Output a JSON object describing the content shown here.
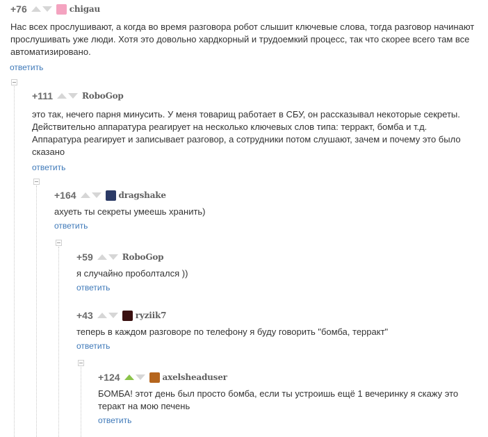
{
  "comments": [
    {
      "rating": "+76",
      "author": "chigau",
      "avatar_color": "#f4a3c0",
      "text": "Нас всех прослушивают, а когда во время разговора робот слышит ключевые слова, тогда разговор начинают прослушивать уже люди. Хотя это довольно хардкорный и трудоемкий процесс, так что скорее всего там все автоматизировано.",
      "reply": "ответить",
      "upvoted": false
    },
    {
      "rating": "+111",
      "author": "RoboGop",
      "avatar_color": "",
      "text": "это так, нечего парня минусить. У меня товарищ работает в СБУ, он рассказывал некоторые секреты. Действительно аппаратура реагирует на несколько ключевых слов типа: терракт, бомба и т.д. Аппаратура реагирует и записывает разговор, а сотрудники потом слушают, зачем и почему это было сказано",
      "reply": "ответить",
      "upvoted": false
    },
    {
      "rating": "+164",
      "author": "dragshake",
      "avatar_color": "#2b3a66",
      "text": "ахуеть ты секреты умеешь хранить)",
      "reply": "ответить",
      "upvoted": false
    },
    {
      "rating": "+59",
      "author": "RoboGop",
      "avatar_color": "",
      "text": "я случайно проболтался ))",
      "reply": "ответить",
      "upvoted": false
    },
    {
      "rating": "+43",
      "author": "ryziik7",
      "avatar_color": "#3a1010",
      "text": "теперь в каждом разговоре по телефону я буду говорить \"бомба, терракт\"",
      "reply": "ответить",
      "upvoted": false
    },
    {
      "rating": "+124",
      "author": "axelsheaduser",
      "avatar_color": "#b5651d",
      "text": "БОМБА! этот день был просто бомба, если ты устроишь ещё 1 вечеринку я скажу это теракт на мою печень",
      "reply": "ответить",
      "upvoted": true
    }
  ]
}
